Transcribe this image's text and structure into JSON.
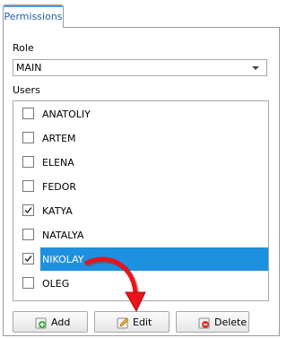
{
  "tab": {
    "label": "Permissions"
  },
  "role": {
    "label": "Role",
    "value": "MAIN"
  },
  "users": {
    "label": "Users",
    "items": [
      {
        "name": "ANATOLIY",
        "checked": false,
        "selected": false
      },
      {
        "name": "ARTEM",
        "checked": false,
        "selected": false
      },
      {
        "name": "ELENA",
        "checked": false,
        "selected": false
      },
      {
        "name": "FEDOR",
        "checked": false,
        "selected": false
      },
      {
        "name": "KATYA",
        "checked": true,
        "selected": false
      },
      {
        "name": "NATALYA",
        "checked": false,
        "selected": false
      },
      {
        "name": "NIKOLAY",
        "checked": true,
        "selected": true
      },
      {
        "name": "OLEG",
        "checked": false,
        "selected": false
      }
    ]
  },
  "buttons": {
    "add": {
      "label": "Add",
      "icon": "add-icon"
    },
    "edit": {
      "label": "Edit",
      "icon": "pencil-icon"
    },
    "delete": {
      "label": "Delete",
      "icon": "delete-icon"
    }
  },
  "colors": {
    "selection": "#1e90e0",
    "arrow": "#e8141a",
    "tab_accent": "#5b9bd5"
  }
}
